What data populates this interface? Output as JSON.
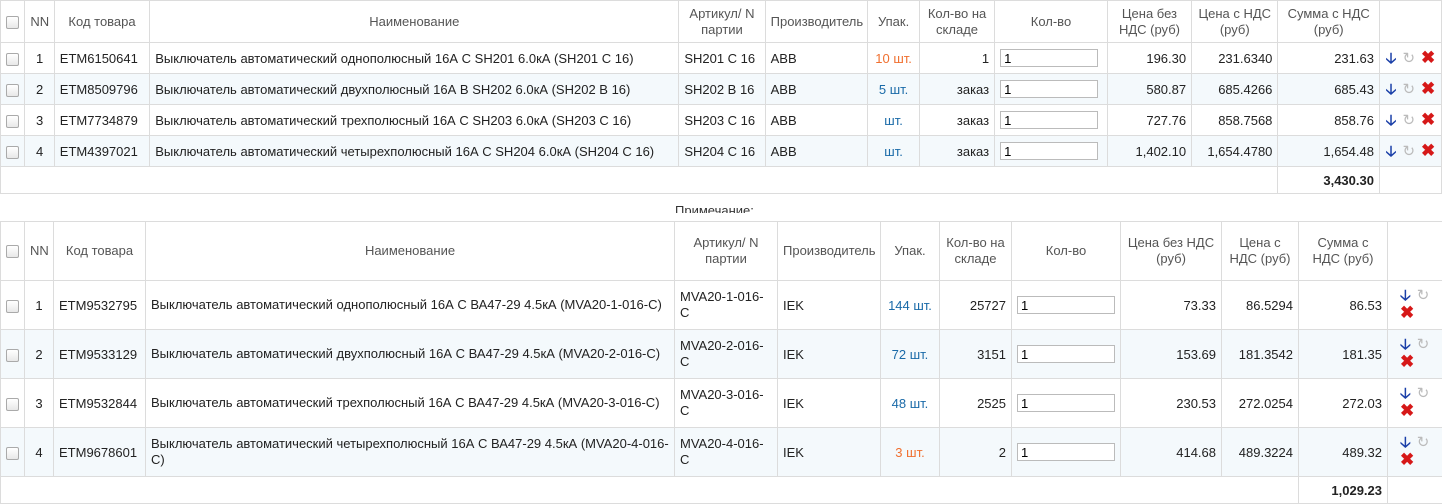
{
  "headers1": {
    "nn": "NN",
    "code": "Код товара",
    "name": "Наименование",
    "article": "Артикул/ N партии",
    "maker": "Производитель",
    "pack": "Упак.",
    "stock": "Кол-во на складе",
    "qty": "Кол-во",
    "price_net": "Цена без НДС (руб)",
    "price_vat": "Цена с НДС (руб)",
    "sum_vat": "Сумма с НДС (руб)"
  },
  "rows1": [
    {
      "nn": "1",
      "code": "ETM6150641",
      "name": "Выключатель автоматический однополюсный 16А С SH201 6.0кА (SH201 C 16)",
      "article": "SH201 C 16",
      "maker": "ABB",
      "pack": "10 шт.",
      "pack_color": "orange",
      "stock": "1",
      "qty": "1",
      "price_net": "196.30",
      "price_vat": "231.6340",
      "sum_vat": "231.63"
    },
    {
      "nn": "2",
      "code": "ETM8509796",
      "name": "Выключатель автоматический двухполюсный 16А В SH202 6.0кА (SH202 B 16)",
      "article": "SH202 B 16",
      "maker": "ABB",
      "pack": "5 шт.",
      "pack_color": "blue",
      "stock": "заказ",
      "qty": "1",
      "price_net": "580.87",
      "price_vat": "685.4266",
      "sum_vat": "685.43"
    },
    {
      "nn": "3",
      "code": "ETM7734879",
      "name": "Выключатель автоматический трехполюсный 16А С SH203 6.0кА (SH203 C 16)",
      "article": "SH203 C 16",
      "maker": "ABB",
      "pack": "шт.",
      "pack_color": "blue",
      "stock": "заказ",
      "qty": "1",
      "price_net": "727.76",
      "price_vat": "858.7568",
      "sum_vat": "858.76"
    },
    {
      "nn": "4",
      "code": "ETM4397021",
      "name": "Выключатель автоматический четырехполюсный 16А С SH204 6.0кА (SH204 C 16)",
      "article": "SH204 C 16",
      "maker": "ABB",
      "pack": "шт.",
      "pack_color": "blue",
      "stock": "заказ",
      "qty": "1",
      "price_net": "1,402.10",
      "price_vat": "1,654.4780",
      "sum_vat": "1,654.48"
    }
  ],
  "total1": "3,430.30",
  "note_label": "Примечание:",
  "headers2": {
    "nn": "NN",
    "code": "Код товара",
    "name": "Наименование",
    "article": "Артикул/ N партии",
    "maker": "Производитель",
    "pack": "Упак.",
    "stock": "Кол-во на складе",
    "qty": "Кол-во",
    "price_net": "Цена без НДС (руб)",
    "price_vat": "Цена с НДС (руб)",
    "sum_vat": "Сумма с НДС (руб)"
  },
  "rows2": [
    {
      "nn": "1",
      "code": "ETM9532795",
      "name": "Выключатель автоматический однополюсный 16А С ВА47-29 4.5кА (MVA20-1-016-C)",
      "article": "MVA20-1-016-C",
      "maker": "IEK",
      "pack": "144 шт.",
      "pack_color": "blue",
      "stock": "25727",
      "qty": "1",
      "price_net": "73.33",
      "price_vat": "86.5294",
      "sum_vat": "86.53"
    },
    {
      "nn": "2",
      "code": "ETM9533129",
      "name": "Выключатель автоматический двухполюсный 16А С ВА47-29 4.5кА (MVA20-2-016-C)",
      "article": "MVA20-2-016-C",
      "maker": "IEK",
      "pack": "72 шт.",
      "pack_color": "blue",
      "stock": "3151",
      "qty": "1",
      "price_net": "153.69",
      "price_vat": "181.3542",
      "sum_vat": "181.35"
    },
    {
      "nn": "3",
      "code": "ETM9532844",
      "name": "Выключатель автоматический трехполюсный 16А С ВА47-29 4.5кА (MVA20-3-016-C)",
      "article": "MVA20-3-016-C",
      "maker": "IEK",
      "pack": "48 шт.",
      "pack_color": "blue",
      "stock": "2525",
      "qty": "1",
      "price_net": "230.53",
      "price_vat": "272.0254",
      "sum_vat": "272.03"
    },
    {
      "nn": "4",
      "code": "ETM9678601",
      "name": "Выключатель автоматический четырехполюсный 16А С ВА47-29 4.5кА (MVA20-4-016-C)",
      "article": "MVA20-4-016-C",
      "maker": "IEK",
      "pack": "3 шт.",
      "pack_color": "orange",
      "stock": "2",
      "qty": "1",
      "price_net": "414.68",
      "price_vat": "489.3224",
      "sum_vat": "489.32"
    }
  ],
  "total2": "1,029.23",
  "icons": {
    "move_down": "arrow-down-icon",
    "refresh": "refresh-icon",
    "delete": "delete-x-icon"
  },
  "colors": {
    "pack_orange": "#f07030",
    "pack_blue": "#1a6aa8",
    "delete_red": "#d61818",
    "move_blue": "#1a3fa8"
  }
}
